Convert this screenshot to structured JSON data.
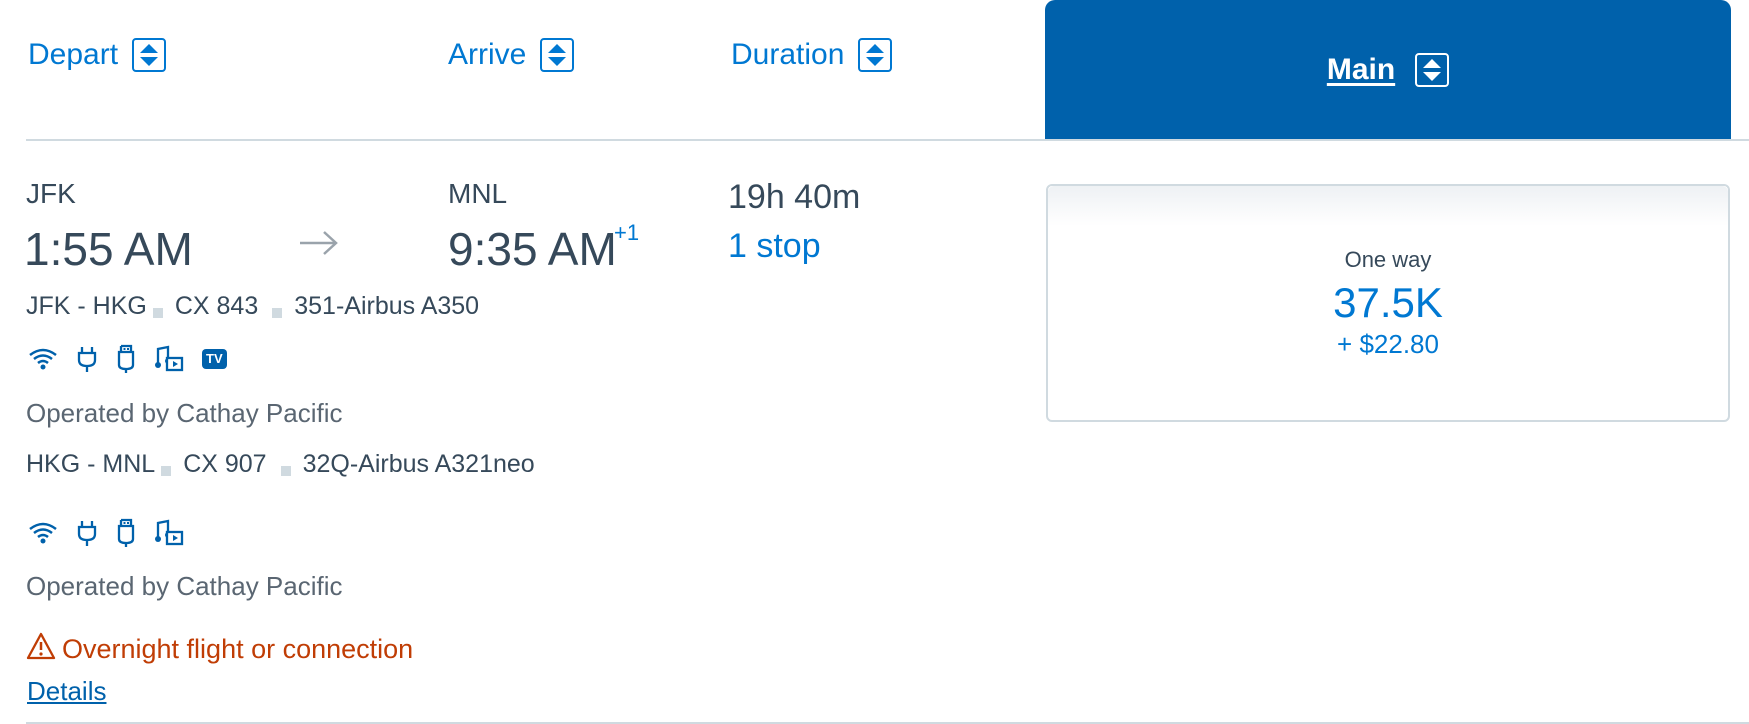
{
  "header": {
    "depart_label": "Depart",
    "arrive_label": "Arrive",
    "duration_label": "Duration",
    "main_label": "Main"
  },
  "flight": {
    "origin_code": "JFK",
    "depart_time": "1:55 AM",
    "dest_code": "MNL",
    "arrive_time": "9:35 AM",
    "arrive_day_offset": "+1",
    "duration": "19h 40m",
    "stops": "1 stop",
    "segments": [
      {
        "route": "JFK - HKG",
        "flight_no": "CX 843",
        "aircraft": "351-Airbus A350",
        "amenities": [
          "wifi-icon",
          "power-icon",
          "usb-icon",
          "entertainment-icon",
          "tv-icon"
        ],
        "tv_badge": "TV",
        "operated_by": "Operated by Cathay Pacific"
      },
      {
        "route": "HKG - MNL",
        "flight_no": "CX 907",
        "aircraft": "32Q-Airbus A321neo",
        "amenities": [
          "wifi-icon",
          "power-icon",
          "usb-icon",
          "entertainment-icon"
        ],
        "operated_by": "Operated by Cathay Pacific"
      }
    ],
    "warning": "Overnight flight or connection",
    "details_link": "Details"
  },
  "price": {
    "trip_type": "One way",
    "miles": "37.5K",
    "fee": "+ $22.80"
  },
  "colors": {
    "accent": "#0078d2",
    "header_bg": "#0061ab",
    "warning": "#c03d05",
    "text": "#36495a"
  }
}
